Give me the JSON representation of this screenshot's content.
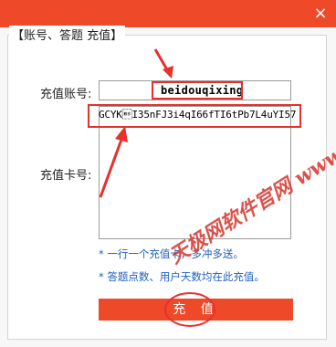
{
  "window": {
    "close_glyph": "×",
    "accent_color": "#ee4a2a"
  },
  "group": {
    "title": "【账号、答题 充值】"
  },
  "form": {
    "account_label": "充值账号:",
    "account_value": "beidouqixing",
    "card_label": "充值卡号:",
    "card_value": "GCYK\bI35nFJ3i4qI66fTI6tPb7L4uYI57"
  },
  "notes": {
    "line1": "* 一行一个充值卡，多冲多送。",
    "line2": "* 答题点数、用户天数均在此充值。"
  },
  "submit": {
    "label": "充 值"
  },
  "watermark": {
    "text": "天极网软件官网 www.tibbfz.com"
  },
  "annotations": {
    "highlight_color": "#e8302c"
  }
}
